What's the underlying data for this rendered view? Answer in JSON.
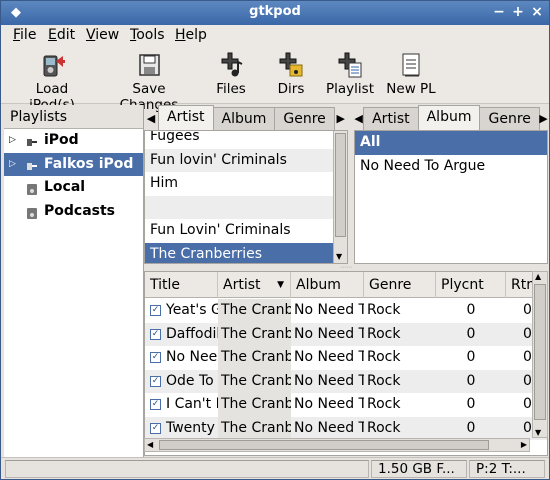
{
  "window": {
    "title": "gtkpod"
  },
  "menu": [
    "File",
    "Edit",
    "View",
    "Tools",
    "Help"
  ],
  "toolbar": [
    {
      "label": "Load iPod(s)",
      "icon": "ipod-load-icon"
    },
    {
      "label": "Save Changes",
      "icon": "save-icon"
    },
    {
      "label": "Files",
      "icon": "add-files-icon"
    },
    {
      "label": "Dirs",
      "icon": "add-dirs-icon"
    },
    {
      "label": "Playlist",
      "icon": "add-playlist-icon"
    },
    {
      "label": "New PL",
      "icon": "new-playlist-icon"
    }
  ],
  "playlists": {
    "header": "Playlists",
    "items": [
      {
        "label": "iPod",
        "expander": "▷",
        "selected": false
      },
      {
        "label": "Falkos iPod",
        "expander": "▷",
        "selected": true
      },
      {
        "label": "Local",
        "expander": "",
        "selected": false
      },
      {
        "label": "Podcasts",
        "expander": "",
        "selected": false
      }
    ]
  },
  "filter1": {
    "tabs": [
      "Artist",
      "Album",
      "Genre"
    ],
    "active_tab": "Artist",
    "items": [
      "Fugees",
      "Fun lovin' Criminals",
      "Him",
      "",
      "Fun Lovin' Criminals",
      "The Cranberries"
    ],
    "selected_index": 5
  },
  "filter2": {
    "tabs": [
      "Artist",
      "Album",
      "Genre"
    ],
    "active_tab": "Album",
    "items": [
      "All",
      "No Need To Argue"
    ],
    "selected_index": 0
  },
  "tracks": {
    "columns": [
      "Title",
      "Artist",
      "Album",
      "Genre",
      "Plycnt",
      "Rtr"
    ],
    "rows": [
      {
        "checked": true,
        "title": "Yeat's G",
        "artist": "The Cranb",
        "album": "No Need T",
        "genre": "Rock",
        "playcount": "0",
        "rating": "0"
      },
      {
        "checked": true,
        "title": "Daffodil",
        "artist": "The Cranb",
        "album": "No Need T",
        "genre": "Rock",
        "playcount": "0",
        "rating": "0"
      },
      {
        "checked": true,
        "title": "No Nee",
        "artist": "The Cranb",
        "album": "No Need T",
        "genre": "Rock",
        "playcount": "0",
        "rating": "0"
      },
      {
        "checked": true,
        "title": "Ode To I",
        "artist": "The Cranb",
        "album": "No Need T",
        "genre": "Rock",
        "playcount": "0",
        "rating": "0"
      },
      {
        "checked": true,
        "title": "I Can't E",
        "artist": "The Cranb",
        "album": "No Need T",
        "genre": "Rock",
        "playcount": "0",
        "rating": "0"
      },
      {
        "checked": true,
        "title": "Twenty",
        "artist": "The Cranb",
        "album": "No Need T",
        "genre": "Rock",
        "playcount": "0",
        "rating": "0"
      }
    ]
  },
  "status": {
    "space": "1.50 GB F...",
    "stats": "P:2 T:..."
  },
  "colors": {
    "titlebar": "#4a74b0",
    "selection": "#4a6ea8"
  }
}
